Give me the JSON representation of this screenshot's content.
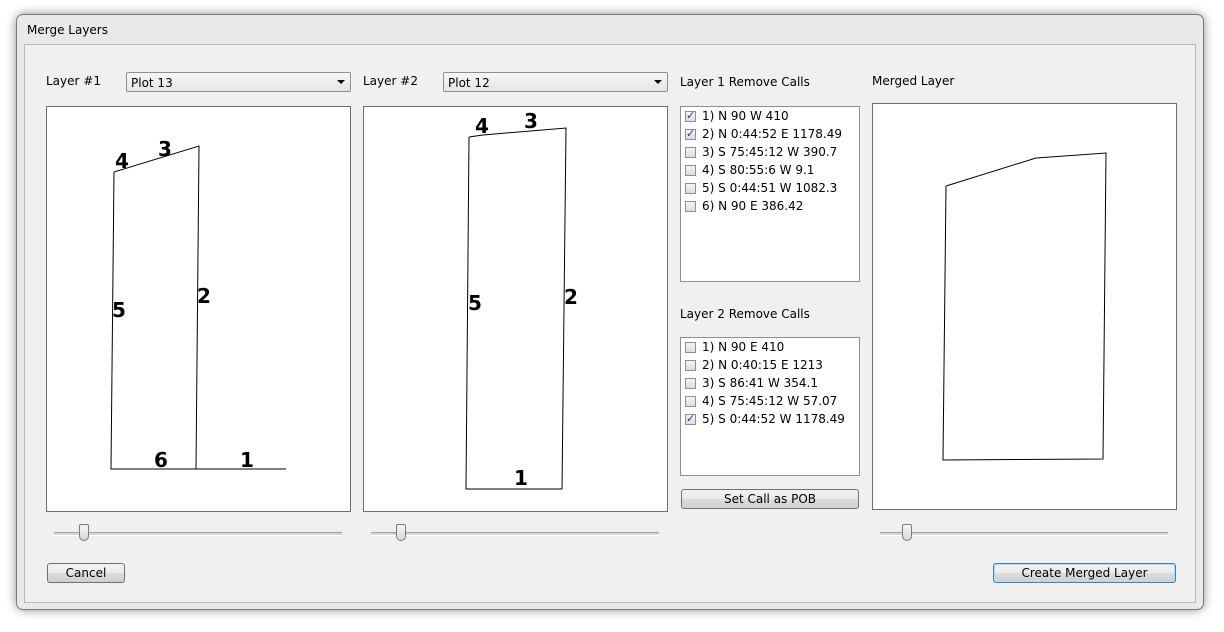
{
  "window": {
    "title": "Merge Layers"
  },
  "layer1": {
    "label": "Layer #1",
    "selected": "Plot 13",
    "numbers": [
      "1",
      "2",
      "3",
      "4",
      "5",
      "6"
    ]
  },
  "layer2": {
    "label": "Layer #2",
    "selected": "Plot 12",
    "numbers": [
      "1",
      "2",
      "3",
      "4",
      "5"
    ]
  },
  "remove1": {
    "label": "Layer 1 Remove Calls",
    "items": [
      {
        "text": "1) N 90 W 410",
        "checked": true
      },
      {
        "text": "2) N 0:44:52 E 1178.49",
        "checked": true
      },
      {
        "text": "3) S 75:45:12 W 390.7",
        "checked": false
      },
      {
        "text": "4) S 80:55:6 W 9.1",
        "checked": false
      },
      {
        "text": "5) S 0:44:51 W 1082.3",
        "checked": false
      },
      {
        "text": "6) N 90 E 386.42",
        "checked": false
      }
    ]
  },
  "remove2": {
    "label": "Layer 2 Remove Calls",
    "items": [
      {
        "text": "1) N 90 E 410",
        "checked": false
      },
      {
        "text": "2) N 0:40:15 E 1213",
        "checked": false
      },
      {
        "text": "3) S 86:41 W 354.1",
        "checked": false
      },
      {
        "text": "4) S 75:45:12 W 57.07",
        "checked": false
      },
      {
        "text": "5) S 0:44:52 W 1178.49",
        "checked": true
      }
    ]
  },
  "merged": {
    "label": "Merged Layer"
  },
  "buttons": {
    "set_pob": "Set Call as POB",
    "cancel": "Cancel",
    "create": "Create Merged Layer"
  },
  "colors": {
    "default_button_border": "#3c7fb1",
    "check": "#1d3b8a"
  }
}
